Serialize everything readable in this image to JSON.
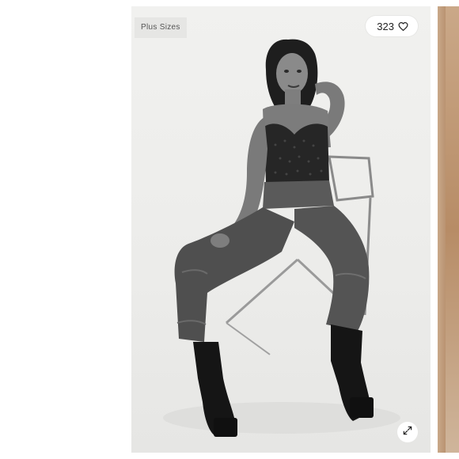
{
  "card": {
    "tag_label": "Plus Sizes",
    "likes_count": "323",
    "icons": {
      "like": "heart-outline-icon",
      "expand": "expand-arrows-icon"
    },
    "photo_description_icon": "model-photo"
  },
  "colors": {
    "card_background": "#ececea",
    "tag_background": "#e6e6e4",
    "likes_pill": "#ffffff",
    "next_card_tint": "#c9a98a"
  }
}
